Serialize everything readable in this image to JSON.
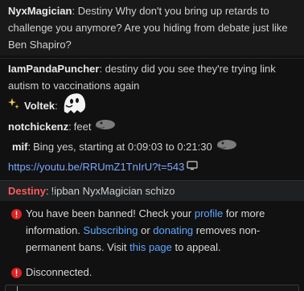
{
  "messages": [
    {
      "user": "NyxMagician",
      "text": "Destiny Why don't you bring up retards to challenge you anymore? Are you hiding from debate just like Ben Shapiro?"
    },
    {
      "user": "IamPandaPuncher",
      "text": "destiny did you see they're trying link autism to vaccinations again"
    },
    {
      "user": "Voltek",
      "text": ""
    },
    {
      "user": "notchickenz",
      "text": "feet"
    },
    {
      "user": "mif",
      "text": "Bing yes, starting at 0:09:03 to 0:21:30"
    },
    {
      "link": "https://youtu.be/RRUmZ1TnIrU?t=543"
    }
  ],
  "highlight": {
    "user": "Destiny",
    "text": "!ipban NyxMagician schizo"
  },
  "system": {
    "ban_part1": "You have been banned! Check your ",
    "profile": "profile",
    "ban_part2": " for more information. ",
    "subscribing": "Subscribing",
    "ban_part3": " or ",
    "donating": "donating",
    "ban_part4": " removes non-permanent bans. Visit ",
    "this_page": "this page",
    "ban_part5": " to appeal.",
    "disconnected": "Disconnected."
  },
  "icons": {
    "alert": "alert-icon",
    "sparkle": "sparkle-icon",
    "tv": "tv-icon"
  },
  "colors": {
    "highlight_user": "#ff5a5a",
    "link": "#7ea7ff",
    "alert": "#d22"
  }
}
